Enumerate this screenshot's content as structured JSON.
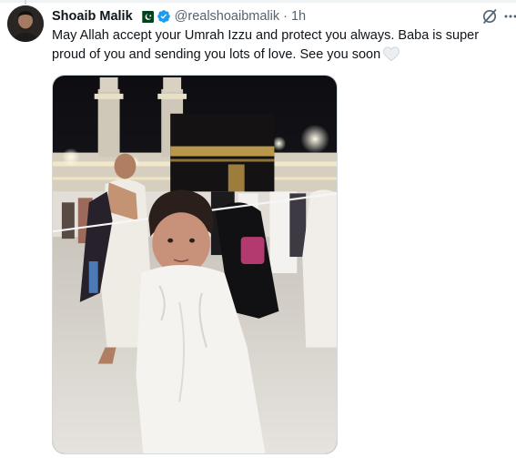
{
  "tweet": {
    "author": {
      "name": "Shoaib Malik",
      "handle": "@realshoaibmalik",
      "flag_icon": "pakistan-flag-icon",
      "verified_icon": "verified-badge-icon",
      "verified_color": "#1d9bf0"
    },
    "separator": "·",
    "timestamp": "1h",
    "text": "May Allah accept your Umrah Izzu and protect you always. Baba is super proud of you and sending you lots of love. See you soon",
    "trailing_emoji_icon": "white-heart-icon",
    "actions": {
      "grok_icon": "grok-icon",
      "more_icon": "more-options-icon"
    },
    "media": {
      "type": "photo"
    }
  },
  "colors": {
    "text_primary": "#0f1419",
    "text_secondary": "#536471",
    "accent": "#1d9bf0",
    "border": "#cfd9de"
  }
}
